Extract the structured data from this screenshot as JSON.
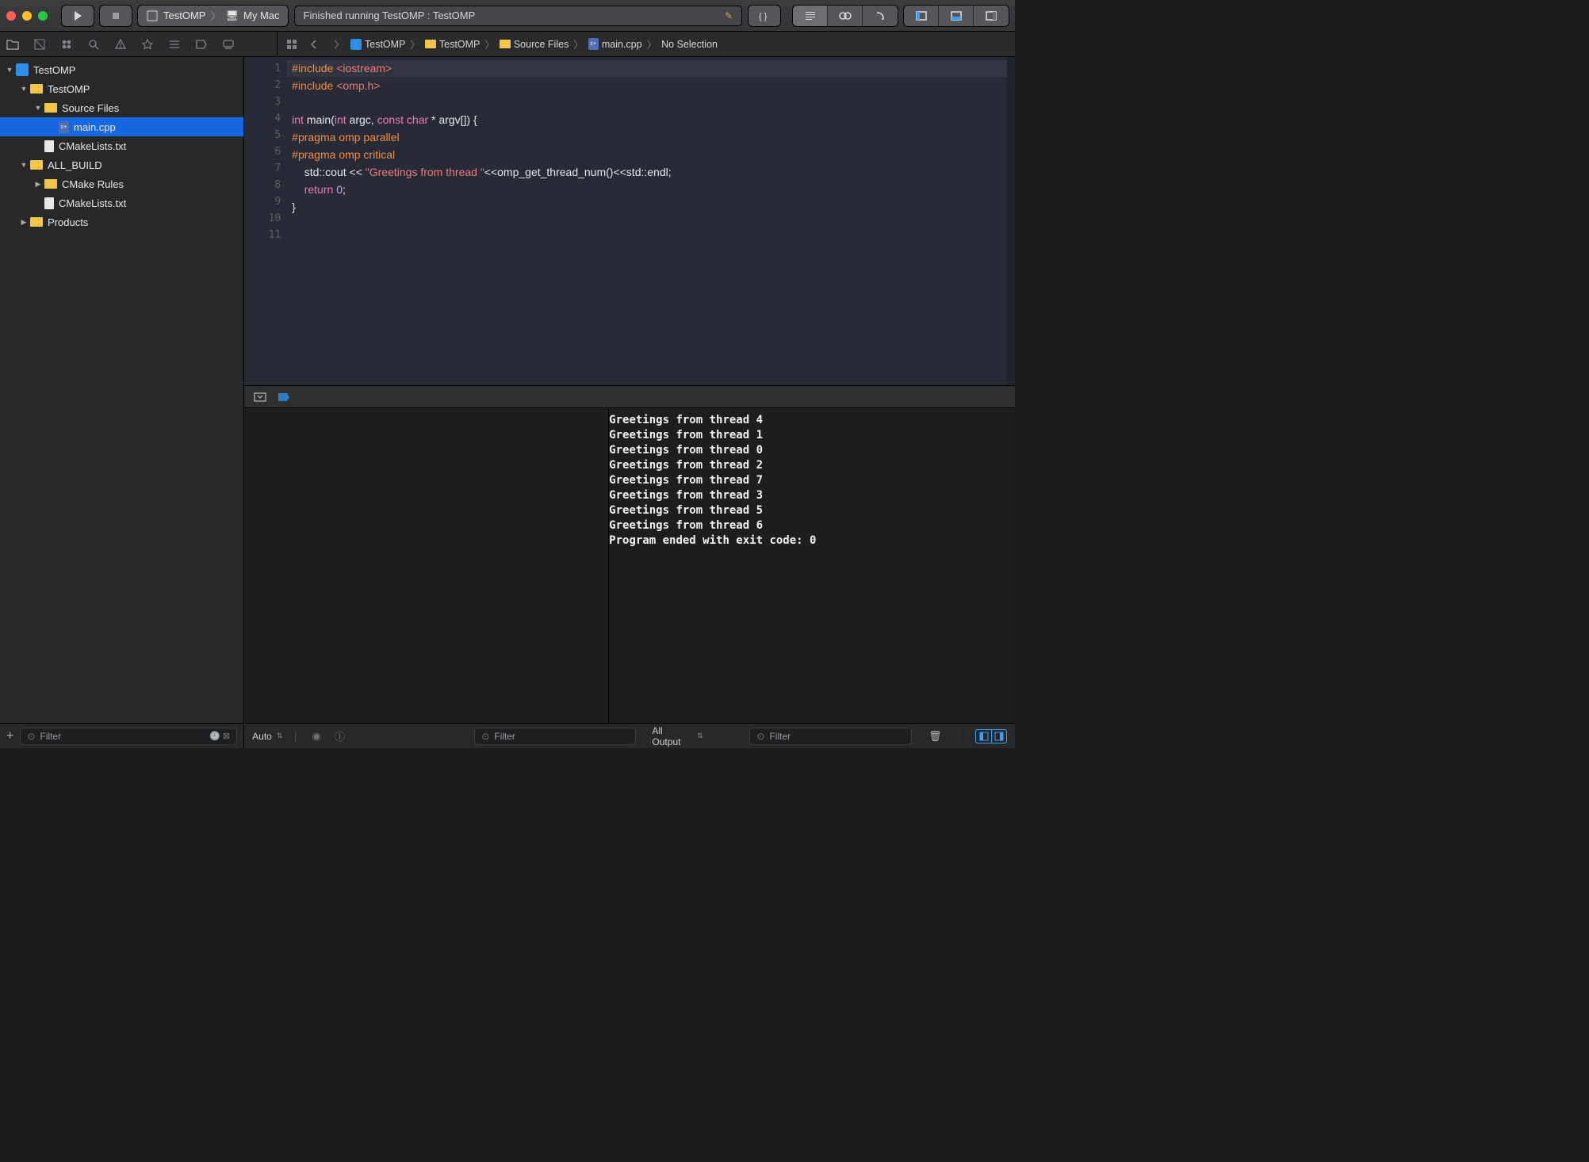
{
  "titlebar": {
    "scheme_target": "TestOMP",
    "scheme_destination": "My Mac",
    "status_text": "Finished running TestOMP : TestOMP"
  },
  "navigator": {
    "filter_placeholder": "Filter",
    "tree": [
      {
        "label": "TestOMP",
        "indent": 0,
        "icon": "proj",
        "open": true
      },
      {
        "label": "TestOMP",
        "indent": 1,
        "icon": "folder",
        "open": true
      },
      {
        "label": "Source Files",
        "indent": 2,
        "icon": "folder",
        "open": true
      },
      {
        "label": "main.cpp",
        "indent": 3,
        "icon": "file-cpp",
        "selected": true
      },
      {
        "label": "CMakeLists.txt",
        "indent": 2,
        "icon": "file"
      },
      {
        "label": "ALL_BUILD",
        "indent": 1,
        "icon": "folder",
        "open": true
      },
      {
        "label": "CMake Rules",
        "indent": 2,
        "icon": "folder",
        "open": false
      },
      {
        "label": "CMakeLists.txt",
        "indent": 2,
        "icon": "file"
      },
      {
        "label": "Products",
        "indent": 1,
        "icon": "folder",
        "open": false
      }
    ]
  },
  "breadcrumb": {
    "items": [
      "TestOMP",
      "TestOMP",
      "Source Files",
      "main.cpp",
      "No Selection"
    ]
  },
  "editor": {
    "lines": 11,
    "code_tokens": [
      [
        [
          "pp",
          "#include"
        ],
        [
          "punc",
          " "
        ],
        [
          "hdr",
          "<iostream>"
        ]
      ],
      [
        [
          "pp",
          "#include"
        ],
        [
          "punc",
          " "
        ],
        [
          "hdr",
          "<omp.h>"
        ]
      ],
      [],
      [
        [
          "kw",
          "int"
        ],
        [
          "punc",
          " "
        ],
        [
          "id",
          "main("
        ],
        [
          "kw",
          "int"
        ],
        [
          "punc",
          " "
        ],
        [
          "id",
          "argc, "
        ],
        [
          "kw",
          "const"
        ],
        [
          "punc",
          " "
        ],
        [
          "kw",
          "char"
        ],
        [
          "punc",
          " * "
        ],
        [
          "id",
          "argv[]) {"
        ]
      ],
      [
        [
          "pp",
          "#pragma omp parallel"
        ]
      ],
      [
        [
          "pp",
          "#pragma omp critical"
        ]
      ],
      [
        [
          "punc",
          "    "
        ],
        [
          "id",
          "std::cout << "
        ],
        [
          "str",
          "\"Greetings from thread \""
        ],
        [
          "id",
          "<<omp_get_thread_num()<<std::endl;"
        ]
      ],
      [
        [
          "punc",
          "    "
        ],
        [
          "kw",
          "return"
        ],
        [
          "punc",
          " "
        ],
        [
          "num",
          "0"
        ],
        [
          "punc",
          ";"
        ]
      ],
      [
        [
          "punc",
          "}"
        ]
      ],
      [],
      []
    ]
  },
  "debug": {
    "auto_label": "Auto",
    "filter_placeholder": "Filter",
    "console_scope": "All Output",
    "console_filter_placeholder": "Filter",
    "console_lines": [
      "Greetings from thread 4",
      "Greetings from thread 1",
      "Greetings from thread 0",
      "Greetings from thread 2",
      "Greetings from thread 7",
      "Greetings from thread 3",
      "Greetings from thread 5",
      "Greetings from thread 6",
      "Program ended with exit code: 0"
    ]
  }
}
